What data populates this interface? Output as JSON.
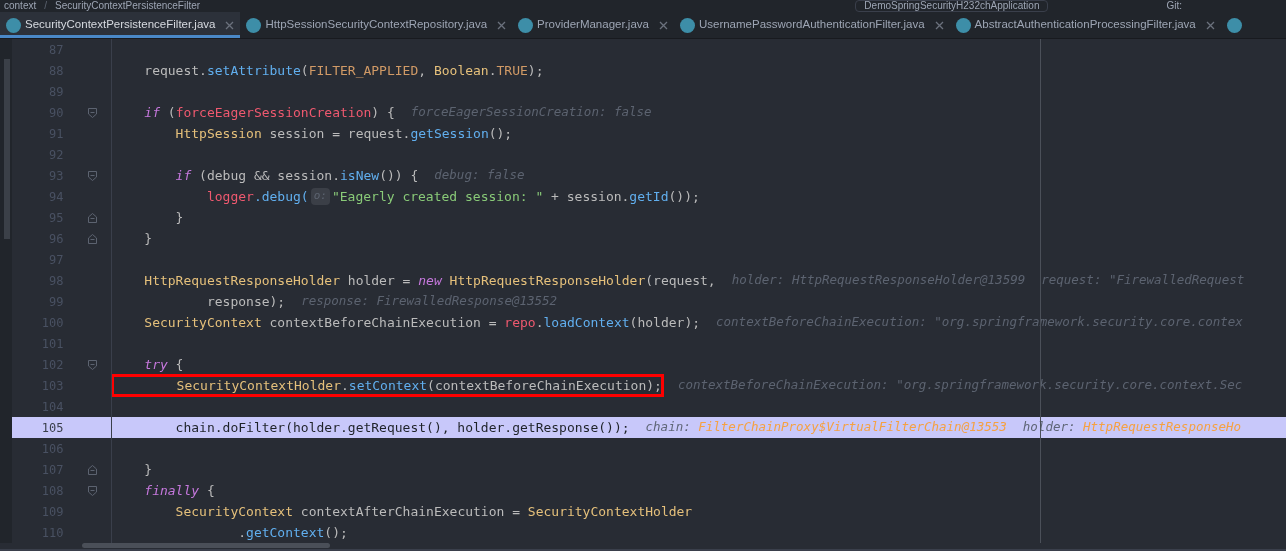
{
  "navigation_bar": {
    "breadcrumbs": [
      "context",
      "SecurityContextPersistenceFilter"
    ],
    "breadcrumb_separator": "/",
    "run_configuration": "DemoSpringSecurityH232chApplication",
    "vcs_label": "Git:"
  },
  "tabs": [
    {
      "label": "SecurityContextPersistenceFilter.java",
      "selected": true
    },
    {
      "label": "HttpSessionSecurityContextRepository.java",
      "selected": false
    },
    {
      "label": "ProviderManager.java",
      "selected": false
    },
    {
      "label": "UsernamePasswordAuthenticationFilter.java",
      "selected": false
    },
    {
      "label": "AbstractAuthenticationProcessingFilter.java",
      "selected": false
    }
  ],
  "editor": {
    "lines": [
      {
        "number": "87"
      },
      {
        "number": "88",
        "parts": [
          {
            "kind": "code",
            "tokens": [
              {
                "text": "    request.",
                "kind": "plain"
              },
              {
                "text": "setAttribute",
                "kind": "method"
              },
              {
                "text": "(",
                "kind": "plain"
              },
              {
                "text": "FILTER_APPLIED",
                "kind": "constant"
              },
              {
                "text": ", ",
                "kind": "plain"
              },
              {
                "text": "Boolean",
                "kind": "type"
              },
              {
                "text": ".",
                "kind": "plain"
              },
              {
                "text": "TRUE",
                "kind": "constant"
              },
              {
                "text": ");",
                "kind": "plain"
              }
            ]
          }
        ]
      },
      {
        "number": "89"
      },
      {
        "number": "90",
        "fold_start": true,
        "parts": [
          {
            "kind": "code",
            "tokens": [
              {
                "text": "    if",
                "kind": "keyword"
              },
              {
                "text": " (",
                "kind": "plain"
              },
              {
                "text": "forceEagerSessionCreation",
                "kind": "field"
              },
              {
                "text": ") {",
                "kind": "plain"
              }
            ]
          },
          {
            "kind": "hint",
            "tokens": [
              {
                "text": "forceEagerSessionCreation: false",
                "kind": "hint"
              }
            ]
          }
        ]
      },
      {
        "number": "91",
        "parts": [
          {
            "kind": "code",
            "tokens": [
              {
                "text": "        HttpSession",
                "kind": "type"
              },
              {
                "text": " session = request.",
                "kind": "plain"
              },
              {
                "text": "getSession",
                "kind": "method"
              },
              {
                "text": "();",
                "kind": "plain"
              }
            ]
          }
        ]
      },
      {
        "number": "92"
      },
      {
        "number": "93",
        "fold_start": true,
        "parts": [
          {
            "kind": "code",
            "tokens": [
              {
                "text": "        if",
                "kind": "keyword"
              },
              {
                "text": " (debug && session.",
                "kind": "plain"
              },
              {
                "text": "isNew",
                "kind": "method"
              },
              {
                "text": "()) {",
                "kind": "plain"
              }
            ]
          },
          {
            "kind": "hint",
            "tokens": [
              {
                "text": "debug: false",
                "kind": "hint"
              }
            ]
          }
        ]
      },
      {
        "number": "94",
        "parts": [
          {
            "kind": "code",
            "tokens": [
              {
                "text": "            logger",
                "kind": "field"
              },
              {
                "text": ".debug(",
                "kind": "method"
              }
            ]
          },
          {
            "kind": "parameter_hint",
            "tokens": [
              {
                "text": "o:",
                "kind": "hint"
              }
            ]
          },
          {
            "kind": "code",
            "tokens": [
              {
                "text": "\"Eagerly created session: \"",
                "kind": "string"
              },
              {
                "text": " + session.",
                "kind": "plain"
              },
              {
                "text": "getId",
                "kind": "method"
              },
              {
                "text": "());",
                "kind": "plain"
              }
            ]
          }
        ]
      },
      {
        "number": "95",
        "fold_end": true,
        "parts": [
          {
            "kind": "code",
            "tokens": [
              {
                "text": "        }",
                "kind": "plain"
              }
            ]
          }
        ]
      },
      {
        "number": "96",
        "fold_end": true,
        "parts": [
          {
            "kind": "code",
            "tokens": [
              {
                "text": "    }",
                "kind": "plain"
              }
            ]
          }
        ]
      },
      {
        "number": "97"
      },
      {
        "number": "98",
        "parts": [
          {
            "kind": "code",
            "tokens": [
              {
                "text": "    HttpRequestResponseHolder",
                "kind": "type"
              },
              {
                "text": " holder = ",
                "kind": "plain"
              },
              {
                "text": "new",
                "kind": "keyword"
              },
              {
                "text": " HttpRequestResponseHolder",
                "kind": "type"
              },
              {
                "text": "(request,",
                "kind": "plain"
              }
            ]
          },
          {
            "kind": "hint",
            "tokens": [
              {
                "text": "holder: HttpRequestResponseHolder@13599",
                "kind": "hint"
              }
            ]
          },
          {
            "kind": "hint",
            "tokens": [
              {
                "text": "request: \"FirewalledRequest",
                "kind": "hint"
              }
            ]
          }
        ]
      },
      {
        "number": "99",
        "parts": [
          {
            "kind": "code",
            "tokens": [
              {
                "text": "            response);",
                "kind": "plain"
              }
            ]
          },
          {
            "kind": "hint",
            "tokens": [
              {
                "text": "response: FirewalledResponse@13552",
                "kind": "hint"
              }
            ]
          }
        ]
      },
      {
        "number": "100",
        "parts": [
          {
            "kind": "code",
            "tokens": [
              {
                "text": "    SecurityContext",
                "kind": "type"
              },
              {
                "text": " contextBeforeChainExecution = ",
                "kind": "plain"
              },
              {
                "text": "repo",
                "kind": "field"
              },
              {
                "text": ".",
                "kind": "plain"
              },
              {
                "text": "loadContext",
                "kind": "method"
              },
              {
                "text": "(holder);",
                "kind": "plain"
              }
            ]
          },
          {
            "kind": "hint",
            "tokens": [
              {
                "text": "contextBeforeChainExecution: \"org.springframework.security.core.contex",
                "kind": "hint"
              }
            ]
          }
        ]
      },
      {
        "number": "101"
      },
      {
        "number": "102",
        "fold_start": true,
        "parts": [
          {
            "kind": "code",
            "tokens": [
              {
                "text": "    try",
                "kind": "keyword"
              },
              {
                "text": " {",
                "kind": "plain"
              }
            ]
          }
        ]
      },
      {
        "number": "103",
        "highlighted": true,
        "parts": [
          {
            "kind": "code",
            "tokens": [
              {
                "text": "        SecurityContextHolder",
                "kind": "type"
              },
              {
                "text": ".",
                "kind": "plain"
              },
              {
                "text": "setContext",
                "kind": "method"
              },
              {
                "text": "(contextBeforeChainExecution);",
                "kind": "plain"
              }
            ]
          },
          {
            "kind": "hint",
            "tokens": [
              {
                "text": "contextBeforeChainExecution: \"org.springframework.security.core.context.Sec",
                "kind": "hint"
              }
            ]
          }
        ]
      },
      {
        "number": "104"
      },
      {
        "number": "105",
        "current": true,
        "parts": [
          {
            "kind": "code",
            "tokens": [
              {
                "text": "        chain.doFilter(holder.getRequest(), holder.getResponse());",
                "kind": "plain"
              }
            ]
          },
          {
            "kind": "hint",
            "tokens": [
              {
                "text": "chain: ",
                "kind": "hint"
              },
              {
                "text": "FilterChainProxy$VirtualFilterChain@13553",
                "kind": "value"
              }
            ]
          },
          {
            "kind": "hint",
            "tokens": [
              {
                "text": "holder: ",
                "kind": "hint"
              },
              {
                "text": "HttpRequestResponseHo",
                "kind": "value"
              }
            ]
          }
        ]
      },
      {
        "number": "106"
      },
      {
        "number": "107",
        "fold_end": true,
        "parts": [
          {
            "kind": "code",
            "tokens": [
              {
                "text": "    }",
                "kind": "plain"
              }
            ]
          }
        ]
      },
      {
        "number": "108",
        "fold_start": true,
        "parts": [
          {
            "kind": "code",
            "tokens": [
              {
                "text": "    finally",
                "kind": "keyword"
              },
              {
                "text": " {",
                "kind": "plain"
              }
            ]
          }
        ]
      },
      {
        "number": "109",
        "parts": [
          {
            "kind": "code",
            "tokens": [
              {
                "text": "        SecurityContext",
                "kind": "type"
              },
              {
                "text": " contextAfterChainExecution = ",
                "kind": "plain"
              },
              {
                "text": "SecurityContextHolder",
                "kind": "type"
              }
            ]
          }
        ]
      },
      {
        "number": "110",
        "parts": [
          {
            "kind": "code",
            "tokens": [
              {
                "text": "                .",
                "kind": "plain"
              },
              {
                "text": "getContext",
                "kind": "method"
              },
              {
                "text": "();",
                "kind": "plain"
              }
            ]
          }
        ]
      }
    ]
  }
}
